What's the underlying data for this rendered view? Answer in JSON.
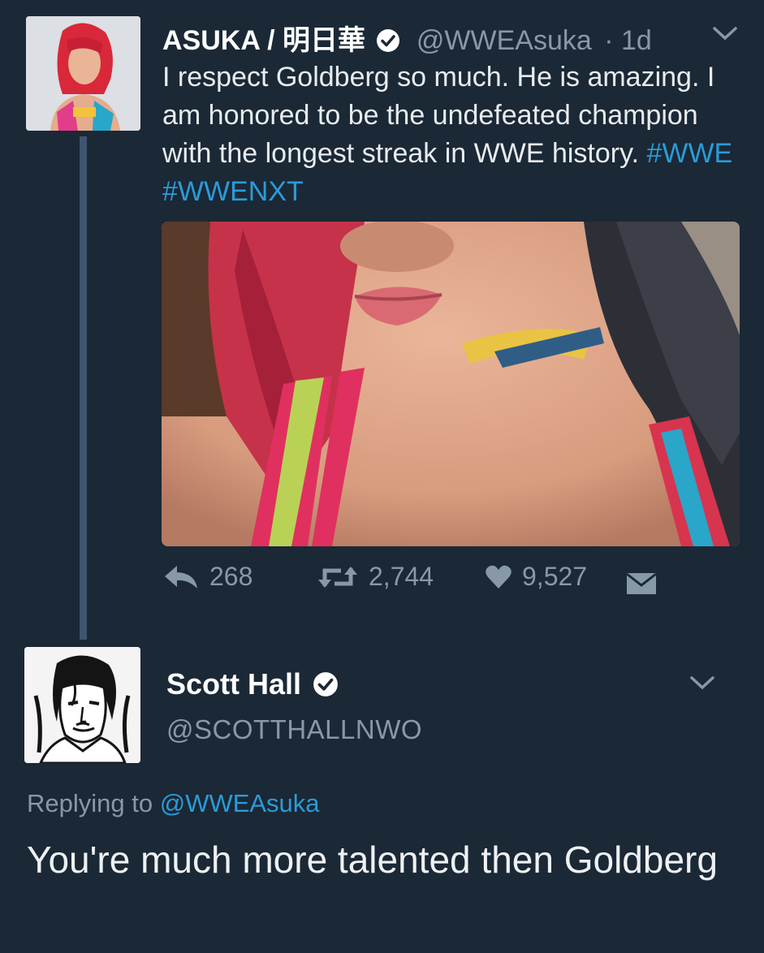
{
  "tweet1": {
    "display_name": "ASUKA / 明日華",
    "handle": "@WWEAsuka",
    "time": "· 1d",
    "text_part1": "I respect Goldberg so much. He is amazing. I am honored to be the undefeated champion with the longest streak in WWE history.",
    "hashtags": [
      "#WWE",
      "#WWENXT"
    ],
    "stats": {
      "replies": "268",
      "retweets": "2,744",
      "likes": "9,527"
    },
    "icons": [
      "reply-icon",
      "retweet-icon",
      "heart-icon",
      "message-icon",
      "chevron-down-icon",
      "verified-badge-icon"
    ]
  },
  "tweet2": {
    "display_name": "Scott Hall",
    "handle": "@SCOTTHALLNWO",
    "replying_label": "Replying to",
    "replying_mention": "@WWEAsuka",
    "text": "You're much more talented then Goldberg"
  },
  "colors": {
    "background": "#1b2836",
    "link": "#2b9bd8",
    "muted": "#8899a6",
    "thread_line": "#3f5570"
  }
}
